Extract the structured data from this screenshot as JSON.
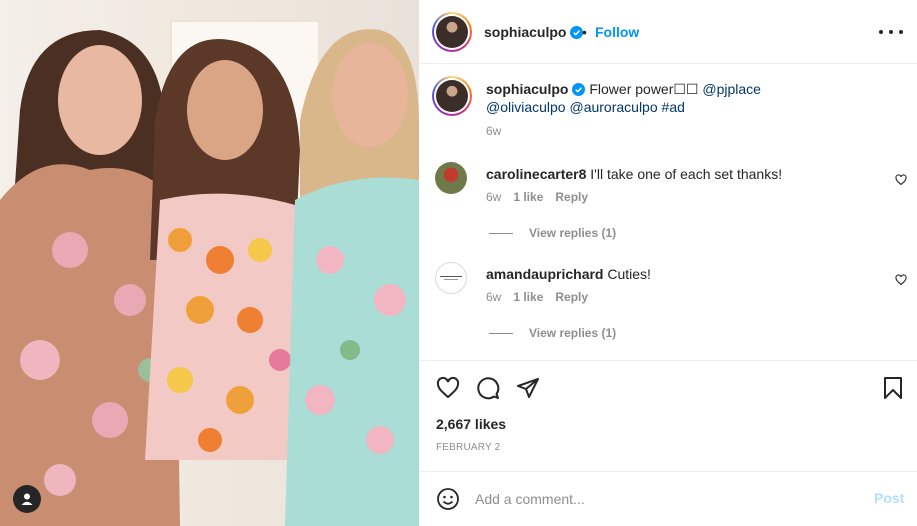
{
  "post": {
    "username": "sophiaculpo",
    "verified": true,
    "follow_label": "Follow",
    "separator": "•",
    "more_icon": "more-horizontal-icon"
  },
  "caption": {
    "username": "sophiaculpo",
    "text_prefix": "Flower power",
    "emoji_placeholder": "☐☐",
    "mentions": [
      "@pjplace",
      "@oliviaculpo",
      "@auroraculpo"
    ],
    "hashtag": "#ad",
    "time": "6w"
  },
  "comments": [
    {
      "username": "carolinecarter8",
      "text": "I'll take one of each set thanks!",
      "time": "6w",
      "likes": "1 like",
      "reply_label": "Reply",
      "view_replies": "View replies (1)"
    },
    {
      "username": "amandauprichard",
      "text": "Cuties!",
      "time": "6w",
      "likes": "1 like",
      "reply_label": "Reply",
      "view_replies": "View replies (1)"
    }
  ],
  "stats": {
    "likes": "2,667 likes",
    "date": "FEBRUARY 2"
  },
  "add_comment": {
    "placeholder": "Add a comment...",
    "post_label": "Post"
  },
  "colors": {
    "accent": "#0095f6",
    "post_disabled": "#b2dffc",
    "muted": "#8e8e8e",
    "text": "#262626",
    "link": "#00376b"
  },
  "icons": {
    "like": "heart-icon",
    "comment": "comment-icon",
    "share": "paper-plane-icon",
    "save": "bookmark-icon",
    "emoji": "smiley-icon",
    "photo_user": "person-tag-icon"
  }
}
